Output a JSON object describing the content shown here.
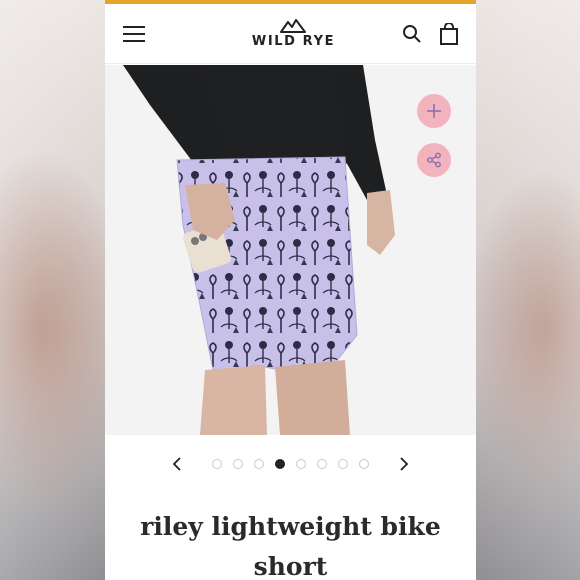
{
  "header": {
    "brand_name": "WILD RYE",
    "icons": [
      "menu-icon",
      "search-icon",
      "shopping-bag-icon"
    ],
    "accent_color": "#e3a52a"
  },
  "gallery": {
    "actions": [
      "plus-icon",
      "share-icon"
    ],
    "action_color": "#f2b3bd",
    "slide_count": 8,
    "active_slide": 4
  },
  "product": {
    "title": "riley lightweight bike short"
  }
}
